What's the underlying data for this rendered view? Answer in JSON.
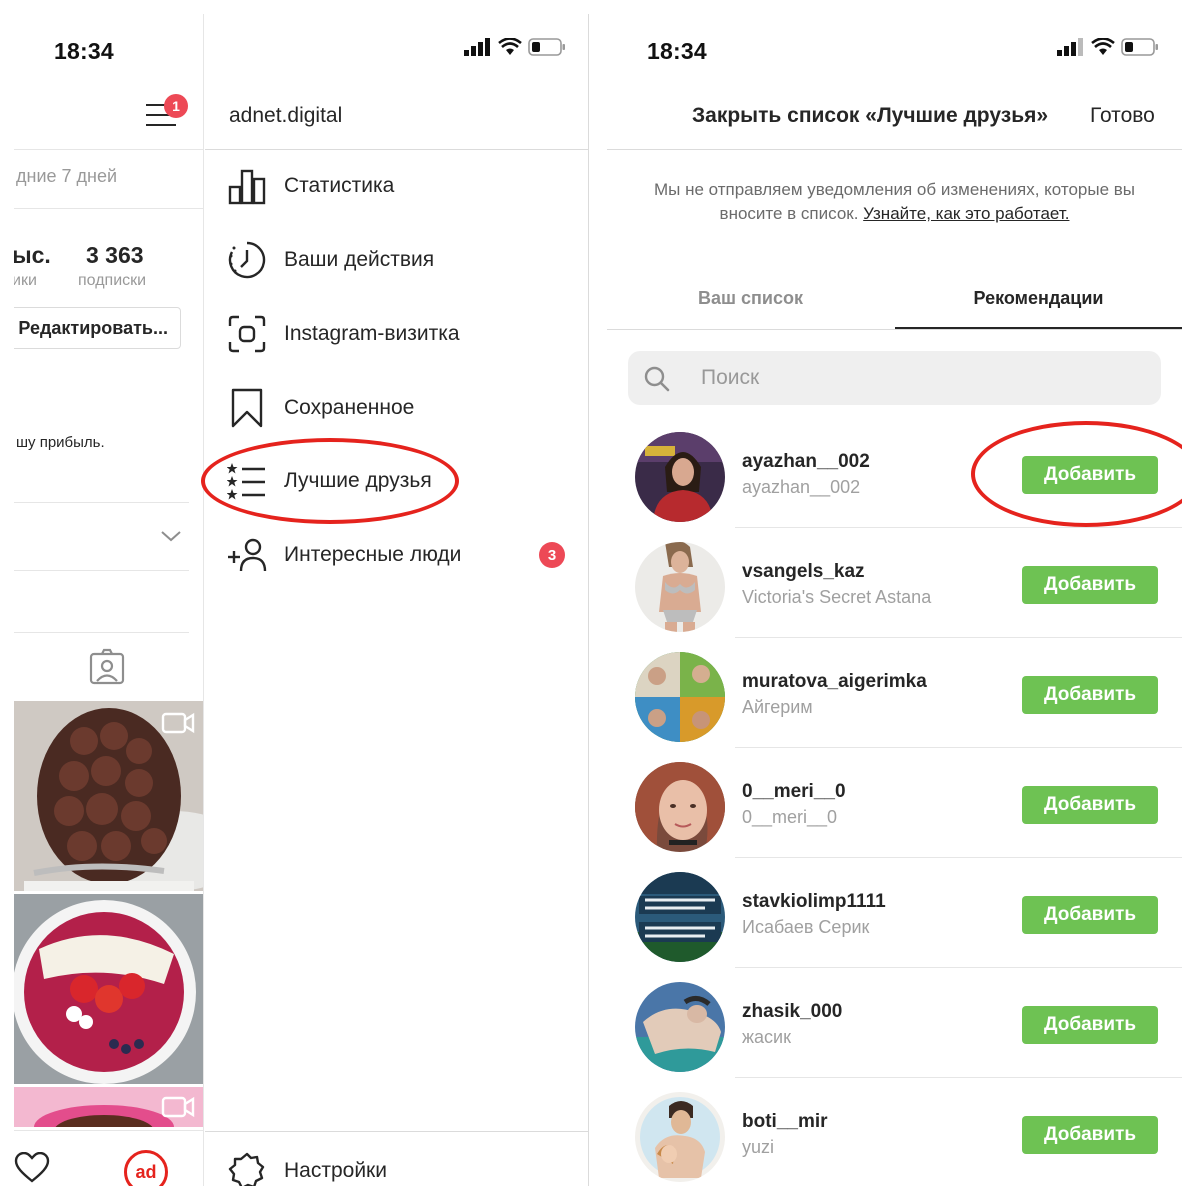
{
  "left": {
    "status_time": "18:34",
    "menu_badge_count": "1",
    "profile": {
      "period_text": "дние 7 дней",
      "stat_a_value": "ыс.",
      "stat_a_label": "ики",
      "stat_b_value": "3 363",
      "stat_b_label": "подписки",
      "edit_button": "Редактировать...",
      "bio_fragment": "шу прибыль."
    },
    "drawer": {
      "username": "adnet.digital",
      "items": [
        {
          "label": "Статистика",
          "icon": "bar-chart-icon"
        },
        {
          "label": "Ваши действия",
          "icon": "activity-clock-icon"
        },
        {
          "label": "Instagram-визитка",
          "icon": "nametag-icon"
        },
        {
          "label": "Сохраненное",
          "icon": "bookmark-icon"
        },
        {
          "label": "Лучшие друзья",
          "icon": "close-friends-list-icon"
        },
        {
          "label": "Интересные люди",
          "icon": "add-person-icon",
          "badge": "3"
        }
      ],
      "settings_label": "Настройки"
    },
    "bottom_bar_avatar_text": "ad"
  },
  "right": {
    "status_time": "18:34",
    "header_title": "Закрыть список «Лучшие друзья»",
    "done_label": "Готово",
    "info_text": "Мы не отправляем уведомления об изменениях, которые вы вносите в список.",
    "info_link": "Узнайте, как это работает.",
    "tabs": [
      "Ваш список",
      "Рекомендации"
    ],
    "active_tab": "Рекомендации",
    "search_placeholder": "Поиск",
    "add_label": "Добавить",
    "users": [
      {
        "username": "ayazhan__002",
        "name": "ayazhan__002"
      },
      {
        "username": "vsangels_kaz",
        "name": "Victoria's Secret Astana"
      },
      {
        "username": "muratova_aigerimka",
        "name": "Айгерим"
      },
      {
        "username": "0__meri__0",
        "name": "0__meri__0"
      },
      {
        "username": "stavkiolimp1111",
        "name": "Исабаев Серик"
      },
      {
        "username": "zhasik_000",
        "name": "жасик"
      },
      {
        "username": "boti__mir",
        "name": "yuzi"
      }
    ]
  },
  "colors": {
    "add_button": "#6ec253",
    "badge": "#ed4956",
    "annotation": "#e5231d"
  }
}
